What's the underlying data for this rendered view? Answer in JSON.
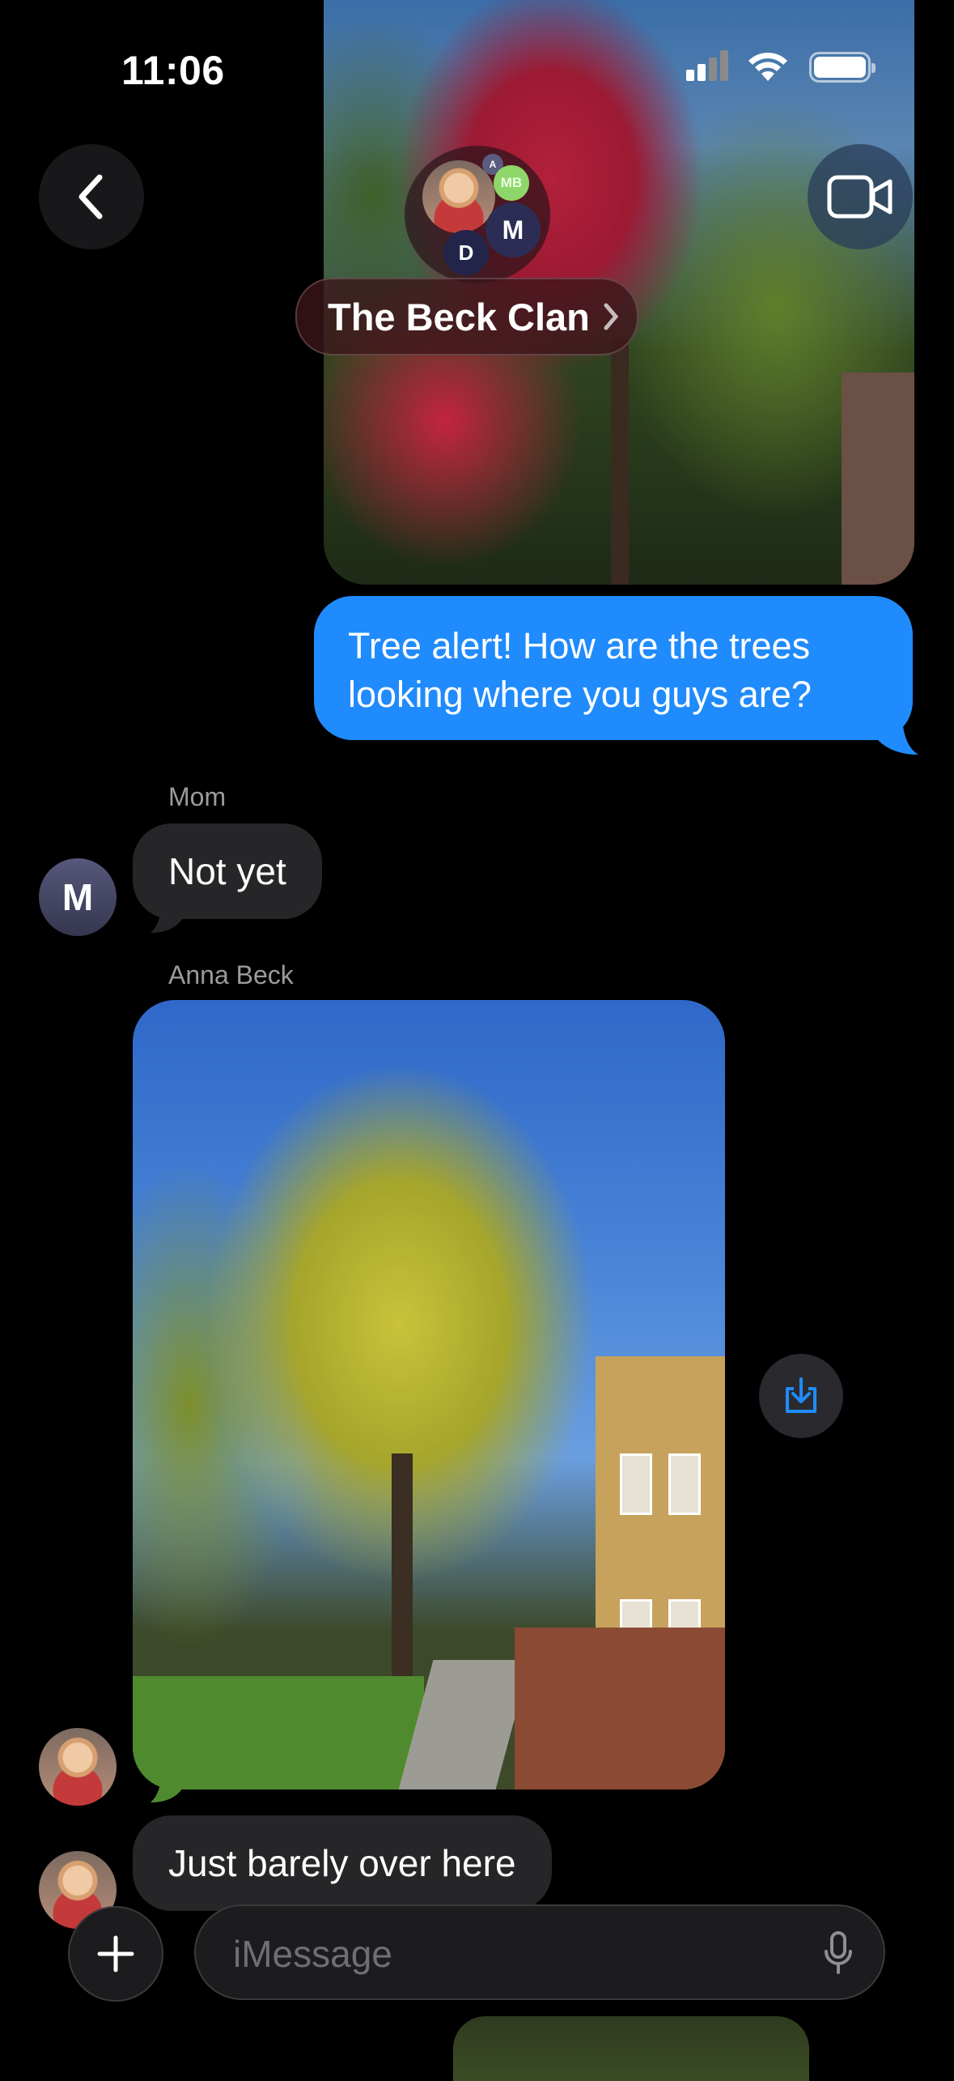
{
  "status_bar": {
    "time": "11:06"
  },
  "header": {
    "group_name": "The Beck Clan",
    "avatars": [
      "A",
      "MB",
      "M",
      "D"
    ]
  },
  "messages": [
    {
      "type": "photo",
      "direction": "outgoing"
    },
    {
      "type": "text",
      "direction": "outgoing",
      "lines": [
        "Tree alert! How are the trees",
        "looking where you guys are?"
      ]
    },
    {
      "type": "text",
      "direction": "incoming",
      "sender": "Mom",
      "avatar_initial": "M",
      "text": "Not yet"
    },
    {
      "type": "photo",
      "direction": "incoming",
      "sender": "Anna Beck"
    },
    {
      "type": "text",
      "direction": "incoming",
      "text": "Just barely over here"
    }
  ],
  "composer": {
    "placeholder": "iMessage"
  },
  "colors": {
    "outgoing_bubble": "#1f8bfd",
    "incoming_bubble": "#262629",
    "background": "#000000",
    "accent": "#1f8bfd"
  },
  "icons": [
    "back-chevron-icon",
    "video-camera-icon",
    "save-icon",
    "plus-icon",
    "microphone-icon",
    "signal-icon",
    "wifi-icon",
    "battery-icon"
  ]
}
